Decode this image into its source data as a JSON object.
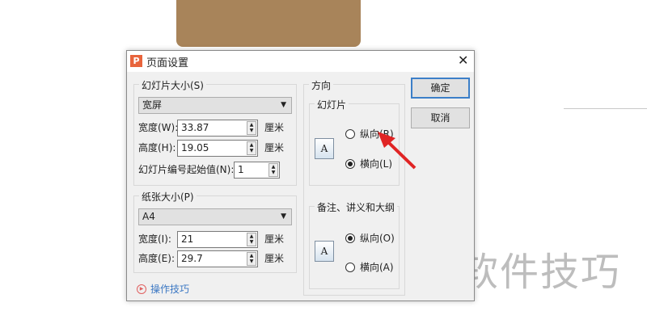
{
  "dialog": {
    "title": "页面设置",
    "close": "✕"
  },
  "slide_size": {
    "legend": "幻灯片大小(S)",
    "preset": "宽屏",
    "width_label": "宽度(W):",
    "width_value": "33.87",
    "height_label": "高度(H):",
    "height_value": "19.05",
    "unit": "厘米",
    "start_label": "幻灯片编号起始值(N):",
    "start_value": "1"
  },
  "paper_size": {
    "legend": "纸张大小(P)",
    "preset": "A4",
    "width_label": "宽度(I):",
    "width_value": "21",
    "height_label": "高度(E):",
    "height_value": "29.7",
    "unit": "厘米"
  },
  "orientation": {
    "legend": "方向",
    "slides": {
      "legend": "幻灯片",
      "portrait": "纵向(R)",
      "landscape": "横向(L)",
      "selected": "landscape"
    },
    "notes": {
      "legend": "备注、讲义和大纲",
      "portrait": "纵向(O)",
      "landscape": "横向(A)",
      "selected": "portrait"
    },
    "page_glyph": "A"
  },
  "buttons": {
    "ok": "确定",
    "cancel": "取消"
  },
  "tips": "操作技巧",
  "logo": "P",
  "watermark": "软件技巧",
  "colors": {
    "accent": "#3c7fc8",
    "arrow": "#e02424",
    "brown": "#a8845a"
  }
}
